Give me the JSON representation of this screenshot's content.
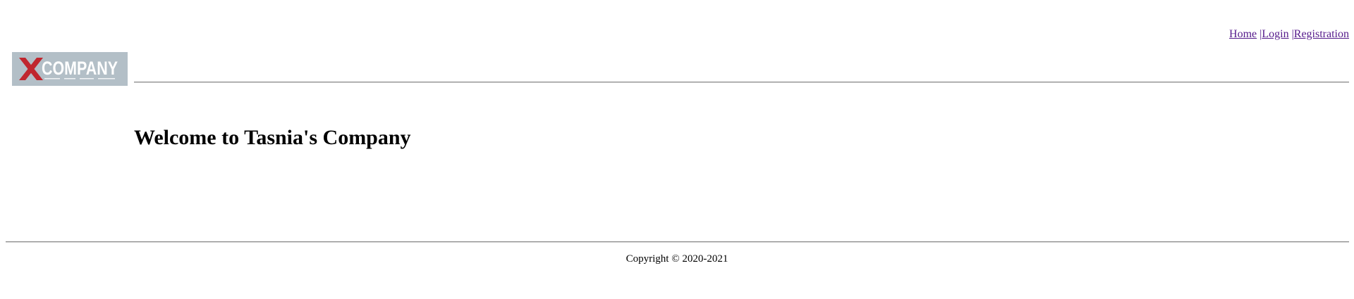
{
  "header": {
    "logo": {
      "text": "COMPANY",
      "icon": "x-logo-icon",
      "background_color": "#b3bfc7",
      "accent_color": "#c0262e"
    },
    "nav": {
      "home_label": "Home",
      "separator": "|",
      "login_label": "Login",
      "registration_label": "Registration",
      "link_color": "#551a8b"
    }
  },
  "main": {
    "title": "Welcome to Tasnia's Company"
  },
  "footer": {
    "copyright": "Copyright © 2020-2021"
  }
}
